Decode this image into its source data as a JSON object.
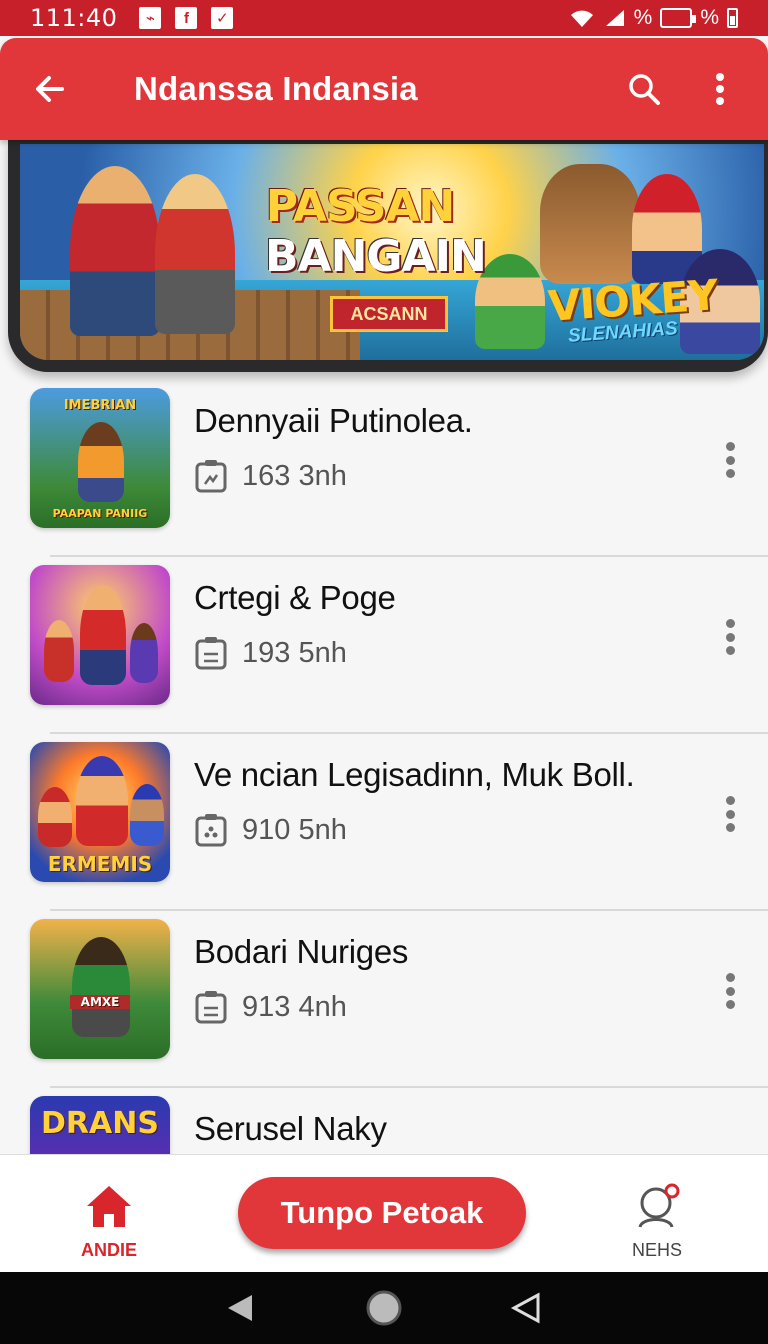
{
  "status_bar": {
    "time": "111:40",
    "notifications": [
      "⌁",
      "f",
      "✓"
    ],
    "battery_text_1": "%",
    "battery_text_2": "%"
  },
  "app_bar": {
    "title": "Ndanssa Indansia",
    "back_icon": "arrow-left-icon",
    "search_icon": "search-icon",
    "more_icon": "more-vertical-icon"
  },
  "banner": {
    "title_line1": "PASSAN",
    "title_line2": "BANGAIN",
    "tag": "ACSANN",
    "logo": "VIOKEY",
    "logo_sub": "SLENAHIAS"
  },
  "games": [
    {
      "title": "Dennyaii Putinolea.",
      "meta": "163 3nh",
      "thumb_top": "IMEBRIAN",
      "thumb_bottom": "PAAPAN PANIIG"
    },
    {
      "title": "Crtegi & Poge",
      "meta": "193 5nh",
      "thumb_top": "",
      "thumb_bottom": ""
    },
    {
      "title": "Ve ncian Legisadinn, Muk Boll.",
      "meta": "910 5nh",
      "thumb_top": "",
      "thumb_bottom": "ERMEMIS"
    },
    {
      "title": "Bodari Nuriges",
      "meta": "913 4nh",
      "thumb_top": "",
      "thumb_bottom": "AMXE"
    },
    {
      "title": "Serusel Naky",
      "meta": "",
      "thumb_top": "DRANS",
      "thumb_bottom": ""
    }
  ],
  "bottom_nav": {
    "home_label": "ANDIE",
    "fab_label": "Tunpo Petoak",
    "news_label": "NEHS"
  },
  "colors": {
    "status_bar": "#c8202a",
    "app_bar": "#e2373a",
    "accent": "#d9262c"
  }
}
